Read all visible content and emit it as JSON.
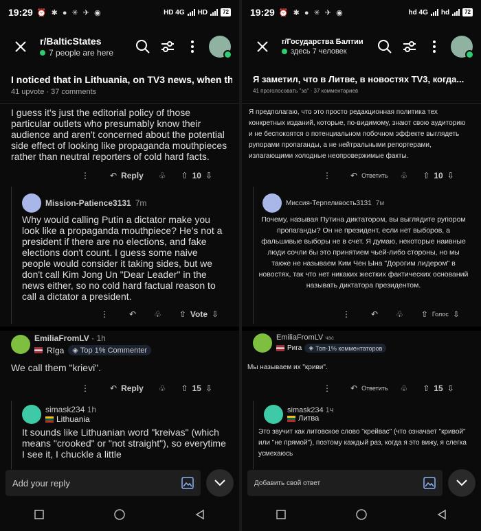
{
  "left": {
    "status": {
      "time": "19:29",
      "icons": "⏰ ✱ ● ✳ ✈ ◉",
      "net": "HD 4G",
      "net2": "HD",
      "battery": "72"
    },
    "appbar": {
      "subreddit": "r/BalticStates",
      "online": "7 people are here"
    },
    "post": {
      "title": "I noticed that in Lithuania, on TV3 news, when the...",
      "meta": "41 upvote · 37 comments"
    },
    "comment1": {
      "text": "I guess it's just the editorial policy of those particular outlets who presumably know their audience and aren't concerned about the potential side effect of looking like propaganda mouthpieces rather than neutral reporters of cold hard facts.",
      "reply": "Reply",
      "votes": "10"
    },
    "comment2": {
      "user": "Mission-Patience3131",
      "time": "7m",
      "text": "Why would calling Putin a dictator make you look like a propaganda mouthpiece? He's not a president if there are no elections, and fake elections don't count. I guess some naive people would consider it taking sides, but we don't call Kim Jong Un \"Dear Leader\" in the news either, so no cold hard factual reason to call a dictator a president.",
      "vote": "Vote"
    },
    "comment3": {
      "user": "EmiliaFromLV",
      "time": "1h",
      "flair": "Rīga",
      "badge": "Top 1% Commenter",
      "text": "We call them \"krievi\".",
      "reply": "Reply",
      "votes": "15"
    },
    "comment4": {
      "user": "simask234",
      "time": "1h",
      "flair": "Lithuania",
      "text": "It sounds like Lithuanian word \"kreivas\" (which means \"crooked\" or \"not straight\"), so everytime I see it, I chuckle a little"
    },
    "replybar": {
      "placeholder": "Add your reply"
    }
  },
  "right": {
    "status": {
      "time": "19:29",
      "icons": "⏰ ✱ ● ✳ ✈ ◉",
      "net": "hd 4G",
      "net2": "hd",
      "battery": "72"
    },
    "appbar": {
      "subreddit": "r/Государства Балтии",
      "online": "здесь 7 человек"
    },
    "post": {
      "title": "Я заметил, что в Литве, в новостях TV3, когда...",
      "meta": "41 проголосовать \"за\" · 37 комментариев"
    },
    "comment1": {
      "text": "Я предполагаю, что это просто редакционная политика тех конкретных изданий, которые, по-видимому, знают свою аудиторию и не беспокоятся о потенциальном побочном эффекте выглядеть рупорами пропаганды, а не нейтральными репортерами, излагающими холодные неопровержимые факты.",
      "reply": "Ответить",
      "votes": "10"
    },
    "comment2": {
      "user": "Миссия-Терпеливость3131",
      "time": "7м",
      "text": "Почему, называя Путина диктатором, вы выглядите рупором пропаганды? Он не президент, если нет выборов, а фальшивые выборы не в счет. Я думаю, некоторые наивные люди сочли бы это принятием чьей-либо стороны, но мы также не называем Ким Чен Ына \"Дорогим лидером\" в новостях, так что нет никаких жестких фактических оснований называть диктатора президентом.",
      "vote": "Голос"
    },
    "comment3": {
      "user": "EmiliaFromLV",
      "time": "час",
      "flair": "Рига",
      "badge": "Топ-1% комментаторов",
      "text": "Мы называем их \"криви\".",
      "reply": "Ответить",
      "votes": "15"
    },
    "comment4": {
      "user": "simask234",
      "time": "1ч",
      "flair": "Литва",
      "text": "Это звучит как литовское слово \"крейвас\" (что означает \"кривой\" или \"не прямой\"), поэтому каждый раз, когда я это вижу, я слегка усмехаюсь"
    },
    "replybar": {
      "placeholder": "Добавить свой ответ"
    }
  },
  "colors": {
    "online": "#2ecc71",
    "background": "#0b0b0b"
  }
}
